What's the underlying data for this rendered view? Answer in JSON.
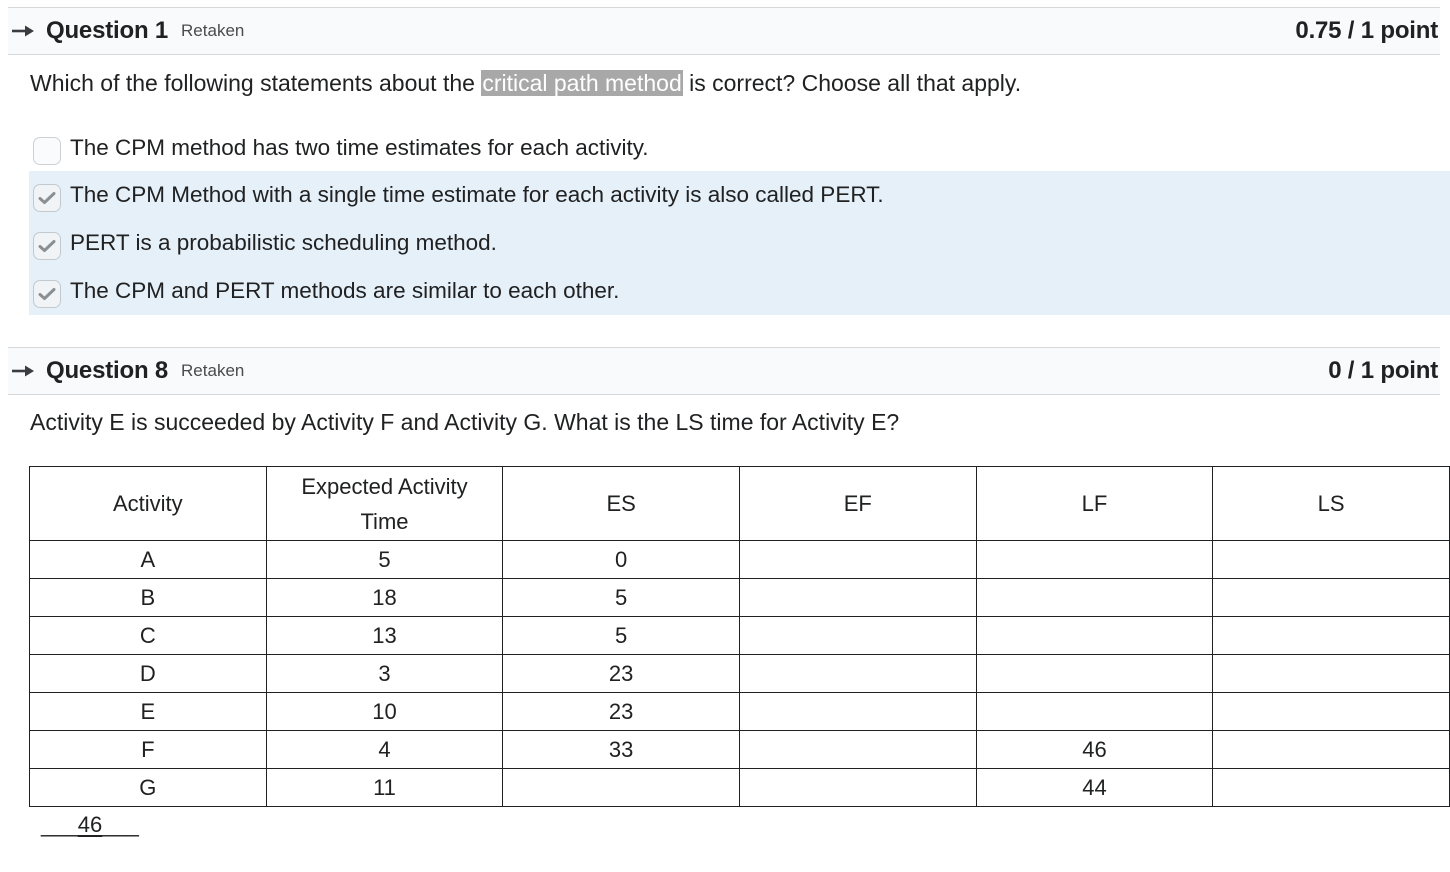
{
  "question1": {
    "title": "Question 1",
    "status": "Retaken",
    "score": "0.75 / 1 point",
    "prompt_before": "Which of the following statements about the ",
    "prompt_highlight": "critical path method",
    "prompt_after": " is correct? Choose all that apply.",
    "options": [
      {
        "label": "The CPM method has two time estimates for each activity.",
        "checked": false
      },
      {
        "label": "The CPM Method with a single time estimate for each activity is also called PERT.",
        "checked": true
      },
      {
        "label": "PERT is a probabilistic scheduling method.",
        "checked": true
      },
      {
        "label": "The CPM and PERT methods are similar to each other.",
        "checked": true
      }
    ]
  },
  "question8": {
    "title": "Question 8",
    "status": "Retaken",
    "score": "0 / 1 point",
    "prompt": "Activity E is succeeded by Activity F and Activity G. What is the LS time for Activity E?",
    "table": {
      "headers": [
        "Activity",
        "Expected Activity Time",
        "ES",
        "EF",
        "LF",
        "LS"
      ],
      "rows": [
        [
          "A",
          "5",
          "0",
          "",
          "",
          ""
        ],
        [
          "B",
          "18",
          "5",
          "",
          "",
          ""
        ],
        [
          "C",
          "13",
          "5",
          "",
          "",
          ""
        ],
        [
          "D",
          "3",
          "23",
          "",
          "",
          ""
        ],
        [
          "E",
          "10",
          "23",
          "",
          "",
          ""
        ],
        [
          "F",
          "4",
          "33",
          "",
          "46",
          ""
        ],
        [
          "G",
          "11",
          "",
          "",
          "44",
          ""
        ]
      ]
    },
    "answer_prefix": "___",
    "answer_value": "46",
    "answer_suffix": "___"
  }
}
